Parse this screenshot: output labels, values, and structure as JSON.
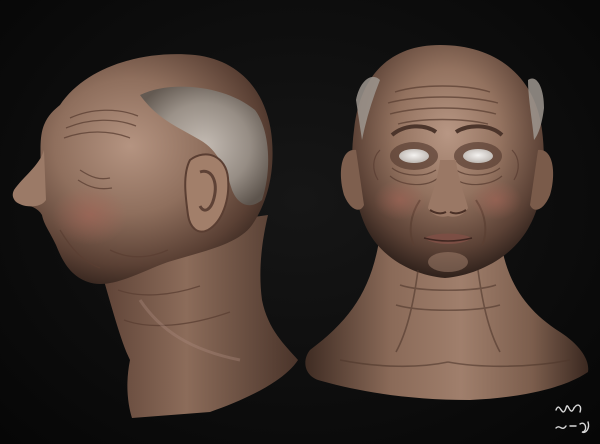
{
  "scene": {
    "subject": "",
    "background_color": "#0c0c0c",
    "skin_base_color": "#8a6a58",
    "skin_light_color": "#b08c78",
    "skin_shadow_color": "#3e2a22",
    "hair_color": "#a9a39c"
  },
  "signature": {
    "kind": "artist-signature",
    "ink_color": "#d8d8d8"
  }
}
